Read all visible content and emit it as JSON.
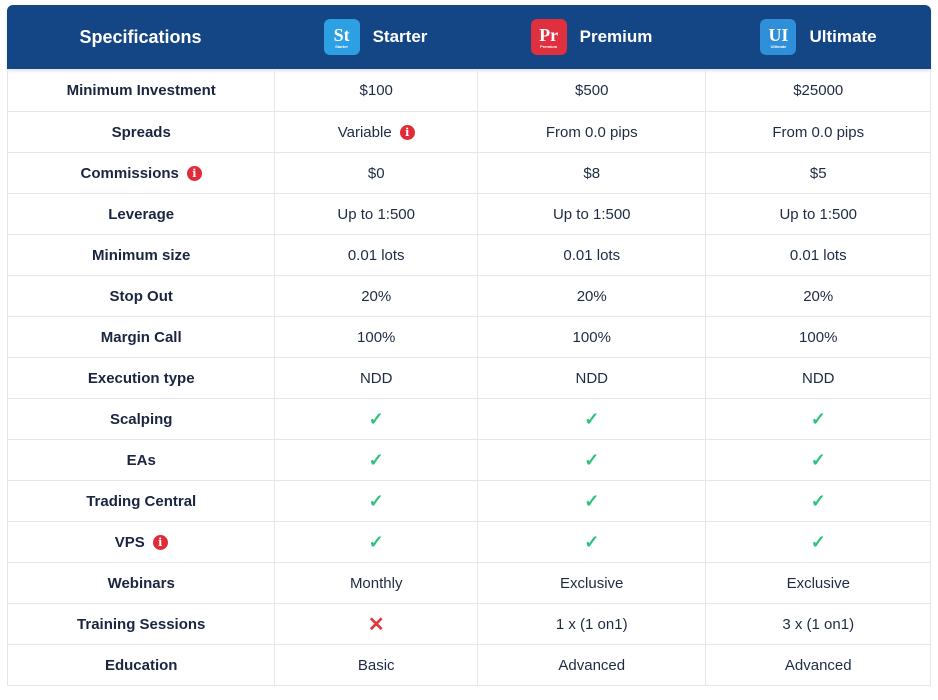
{
  "header": {
    "title": "Specifications",
    "plans": [
      {
        "abbr": "St",
        "small": "Starter",
        "name": "Starter",
        "color": "#2d9fe3"
      },
      {
        "abbr": "Pr",
        "small": "Premium",
        "name": "Premium",
        "color": "#e0303f"
      },
      {
        "abbr": "UI",
        "small": "Ultimate",
        "name": "Ultimate",
        "color": "#2f8fd8"
      }
    ]
  },
  "rows": [
    {
      "label": "Minimum Investment",
      "values": [
        "$100",
        "$500",
        "$25000"
      ]
    },
    {
      "label": "Spreads",
      "values": [
        "Variable",
        "From 0.0 pips",
        "From 0.0 pips"
      ],
      "info_on_first_value": true
    },
    {
      "label": "Commissions",
      "label_info": true,
      "values": [
        "$0",
        "$8",
        "$5"
      ]
    },
    {
      "label": "Leverage",
      "values": [
        "Up to 1:500",
        "Up to 1:500",
        "Up to 1:500"
      ]
    },
    {
      "label": "Minimum size",
      "values": [
        "0.01 lots",
        "0.01 lots",
        "0.01 lots"
      ]
    },
    {
      "label": "Stop Out",
      "values": [
        "20%",
        "20%",
        "20%"
      ]
    },
    {
      "label": "Margin Call",
      "values": [
        "100%",
        "100%",
        "100%"
      ]
    },
    {
      "label": "Execution type",
      "values": [
        "NDD",
        "NDD",
        "NDD"
      ]
    },
    {
      "label": "Scalping",
      "values": [
        "✓",
        "✓",
        "✓"
      ]
    },
    {
      "label": "EAs",
      "values": [
        "✓",
        "✓",
        "✓"
      ]
    },
    {
      "label": "Trading Central",
      "values": [
        "✓",
        "✓",
        "✓"
      ]
    },
    {
      "label": "VPS",
      "label_info": true,
      "values": [
        "✓",
        "✓",
        "✓"
      ]
    },
    {
      "label": "Webinars",
      "values": [
        "Monthly",
        "Exclusive",
        "Exclusive"
      ]
    },
    {
      "label": "Training Sessions",
      "values": [
        "✕",
        "1 x (1 on1)",
        "3 x (1 on1)"
      ]
    },
    {
      "label": "Education",
      "values": [
        "Basic",
        "Advanced",
        "Advanced"
      ]
    }
  ],
  "icons": {
    "info": "info-icon",
    "check": "check-icon",
    "cross": "cross-icon"
  },
  "colors": {
    "header_bg": "#144585",
    "check": "#2ec27e",
    "cross": "#e03a3a",
    "info": "#e02b38"
  }
}
